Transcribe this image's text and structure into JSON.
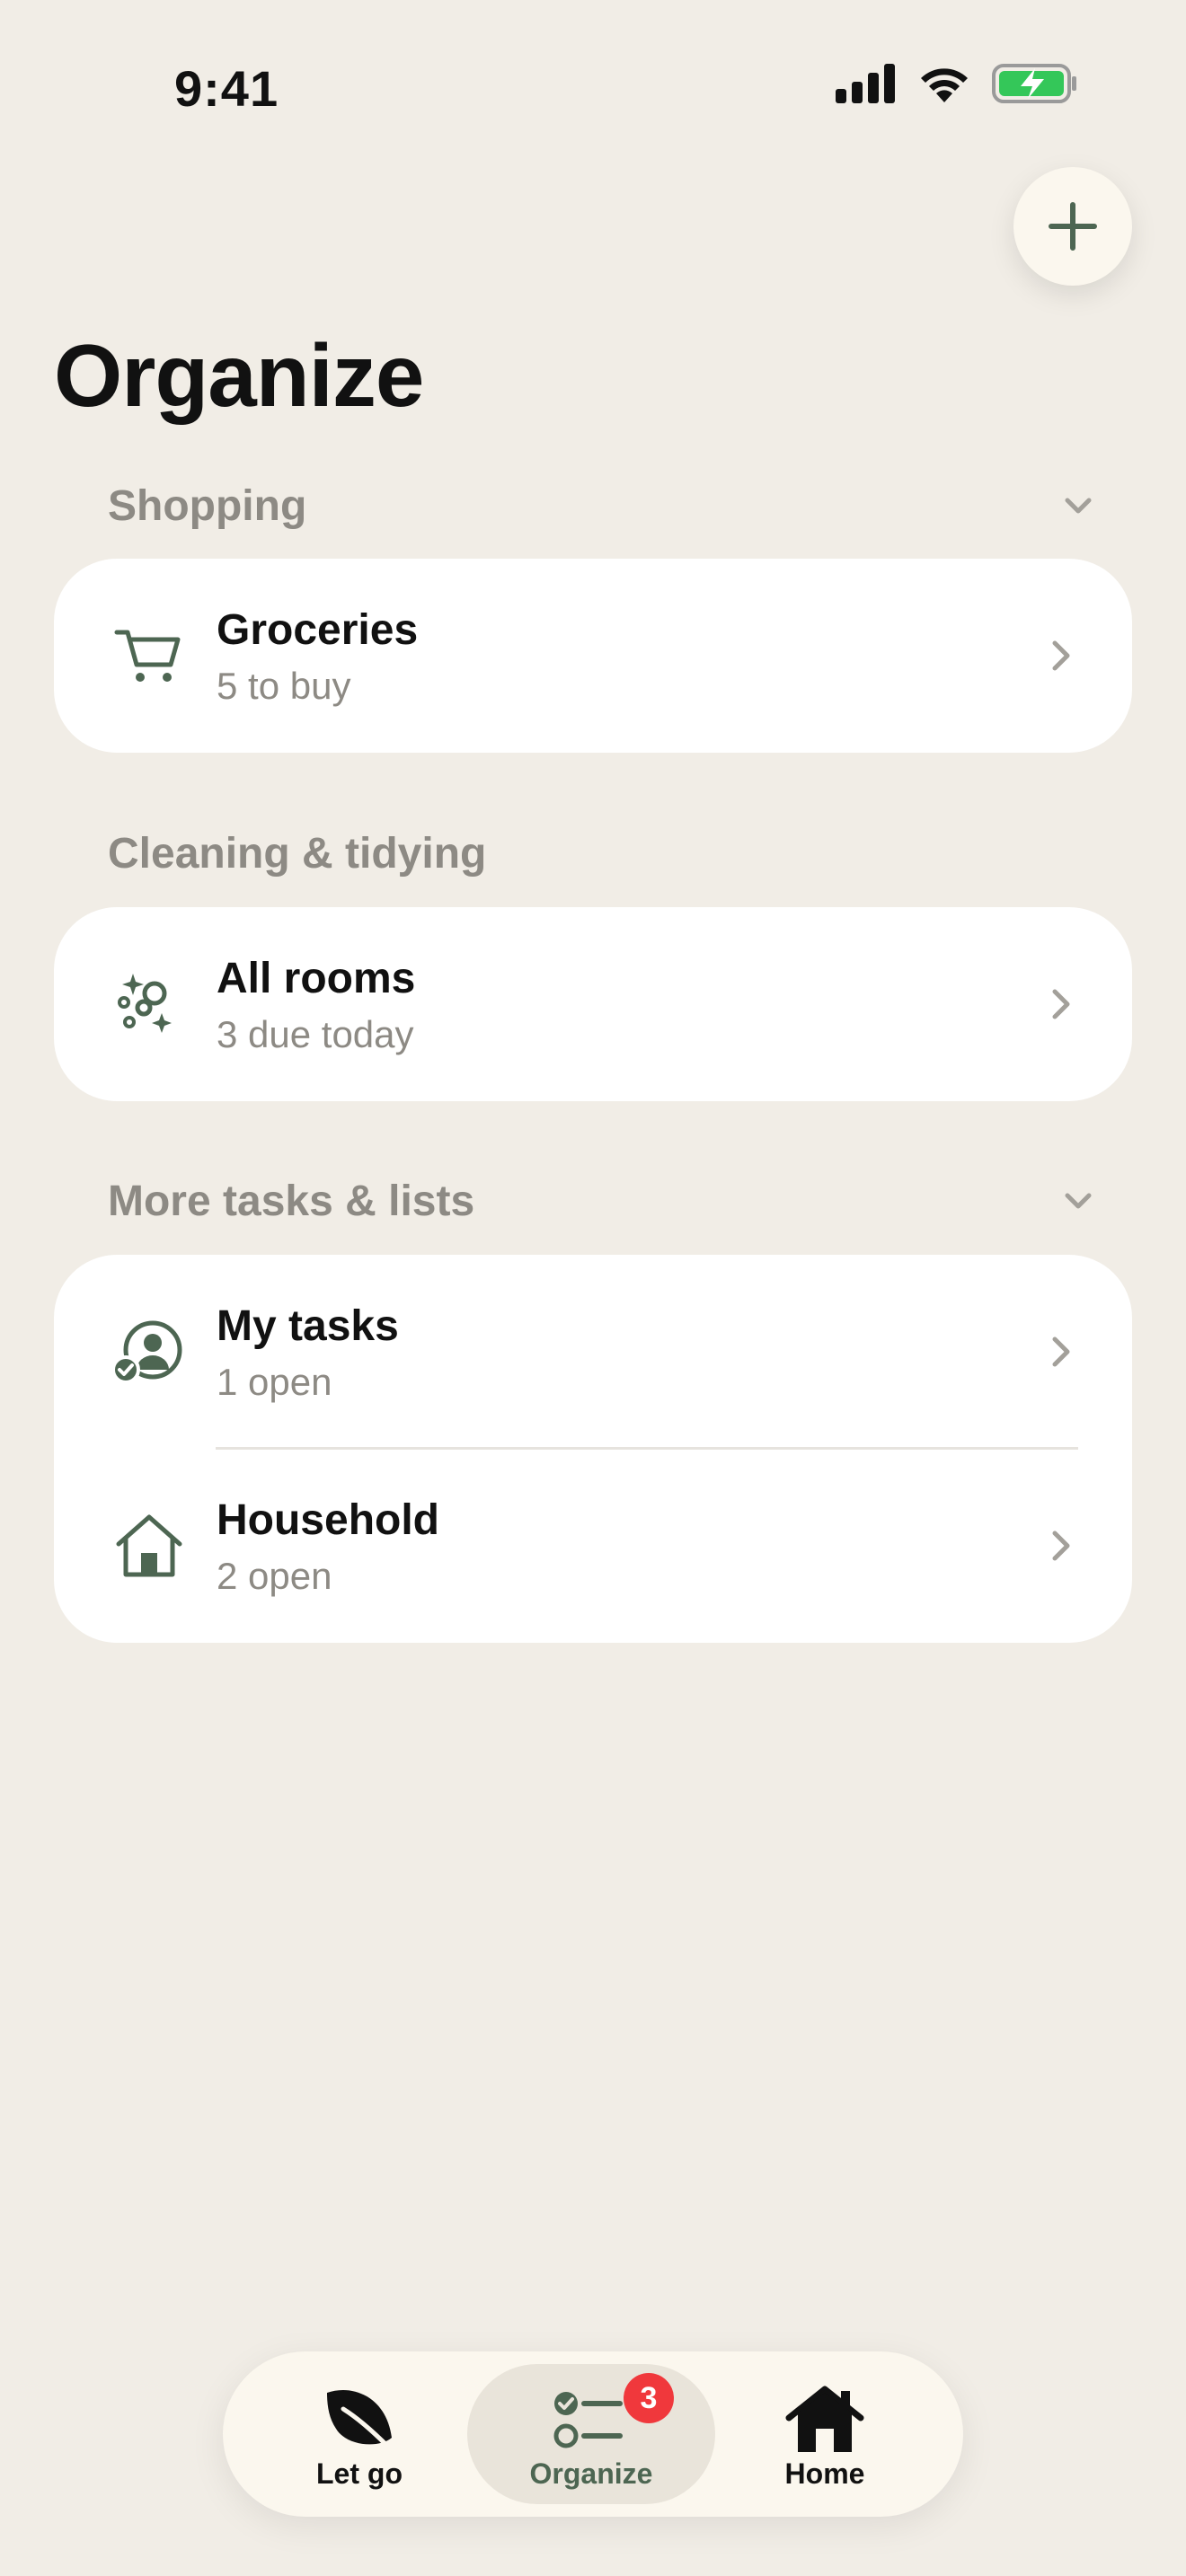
{
  "status_bar": {
    "time": "9:41"
  },
  "page": {
    "title": "Organize"
  },
  "sections": [
    {
      "label": "Shopping",
      "items": [
        {
          "title": "Groceries",
          "subtitle": "5 to buy",
          "icon": "cart-icon"
        }
      ]
    },
    {
      "label": "Cleaning & tidying",
      "items": [
        {
          "title": "All rooms",
          "subtitle": "3 due today",
          "icon": "sparkles-bubbles-icon"
        }
      ]
    },
    {
      "label": "More tasks & lists",
      "items": [
        {
          "title": "My tasks",
          "subtitle": "1 open",
          "icon": "user-check-icon"
        },
        {
          "title": "Household",
          "subtitle": "2 open",
          "icon": "house-icon"
        }
      ]
    }
  ],
  "tabbar": {
    "tabs": [
      {
        "label": "Let go",
        "icon": "leaf-icon",
        "active": false
      },
      {
        "label": "Organize",
        "icon": "checklist-icon",
        "active": true,
        "badge": "3"
      },
      {
        "label": "Home",
        "icon": "home-icon",
        "active": false
      }
    ]
  },
  "colors": {
    "background": "#F1EDE6",
    "accent": "#4D6652",
    "badge": "#F0383C",
    "muted_text": "#8D8A84"
  }
}
